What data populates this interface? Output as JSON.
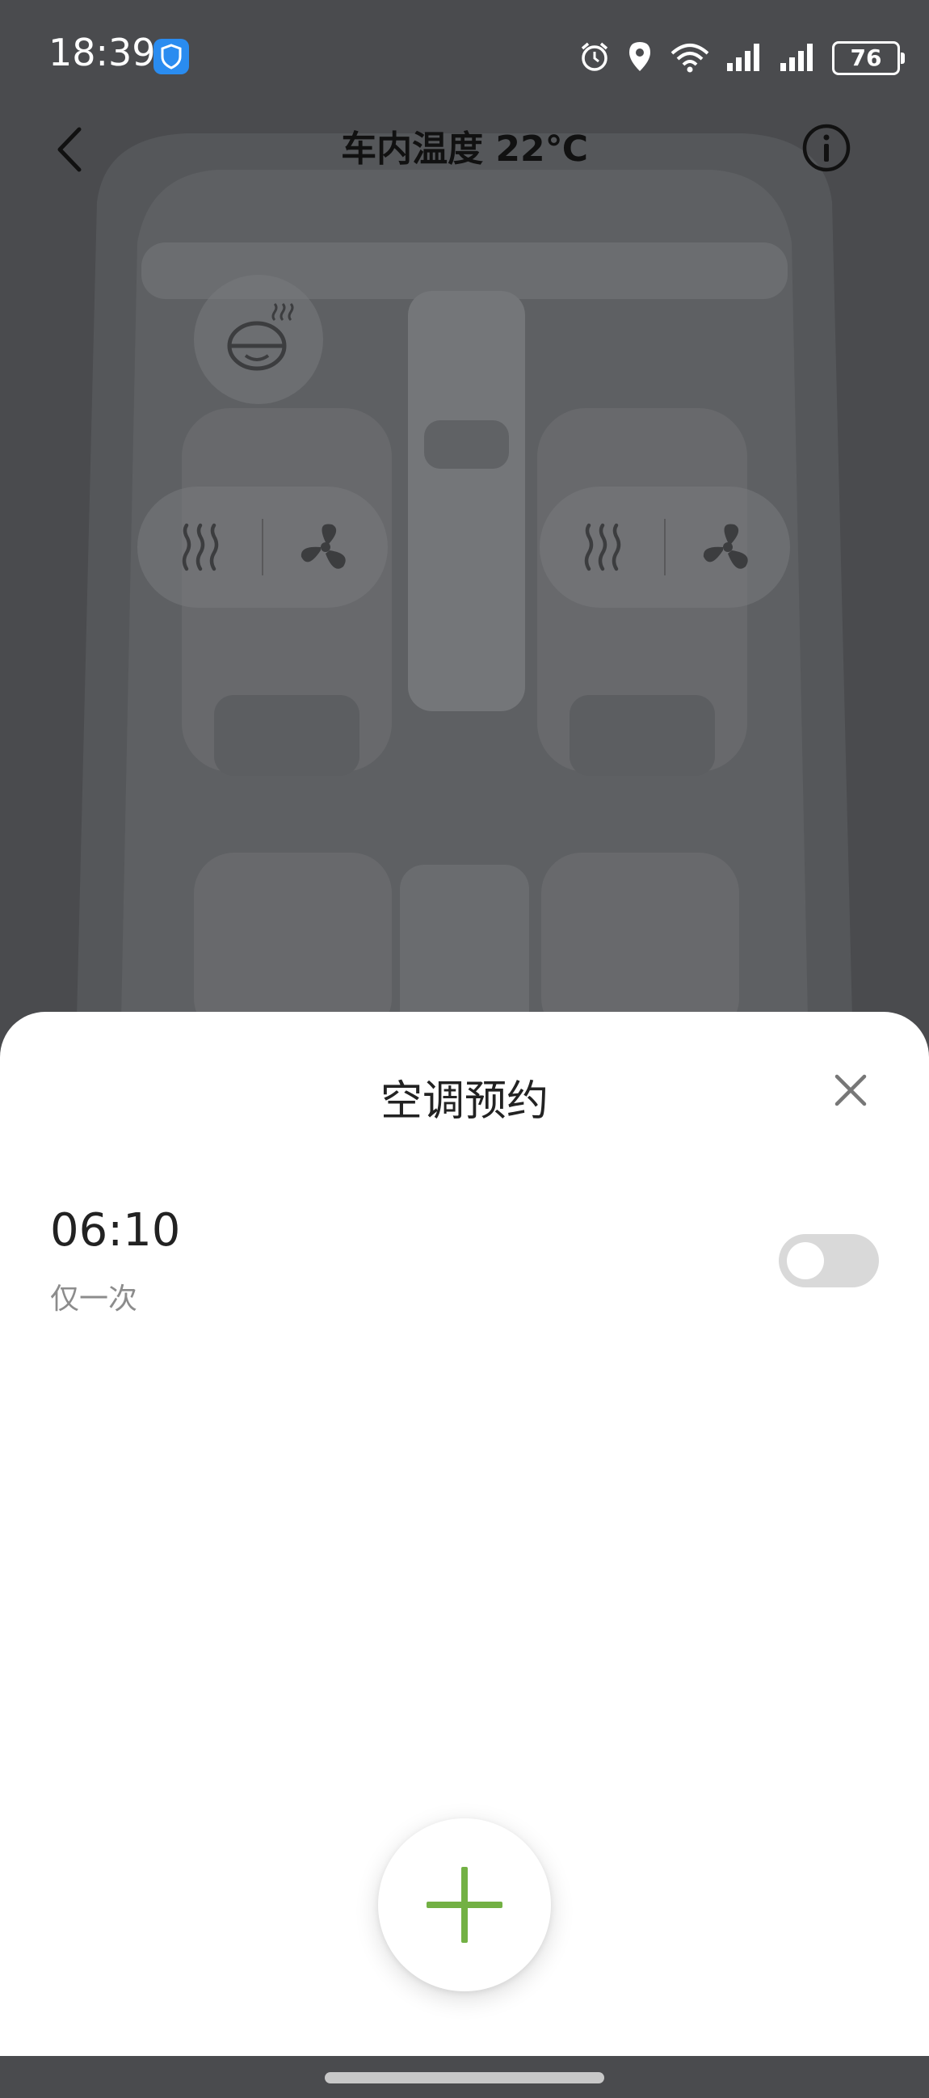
{
  "status_bar": {
    "time": "18:39",
    "battery": "76",
    "icons": [
      "app-shield-icon",
      "alarm-icon",
      "location-icon",
      "wifi-icon",
      "signal-icon",
      "signal-icon",
      "battery-icon"
    ]
  },
  "header": {
    "title": "车内温度 22℃",
    "back_icon": "chevron-left-icon",
    "info_icon": "info-icon"
  },
  "car_controls": {
    "steering_heat_icon": "steering-wheel-heat-icon",
    "left_seat": [
      "seat-heat-icon",
      "seat-fan-icon"
    ],
    "right_seat": [
      "seat-heat-icon",
      "seat-fan-icon"
    ]
  },
  "sheet": {
    "title": "空调预约",
    "close_icon": "close-icon",
    "schedules": [
      {
        "time": "06:10",
        "repeat": "仅一次",
        "enabled": false
      }
    ],
    "add_icon": "plus-icon"
  },
  "colors": {
    "accent": "#73b144",
    "toggle_off": "#d9d9d9",
    "overlay": "#4a4b4e"
  }
}
